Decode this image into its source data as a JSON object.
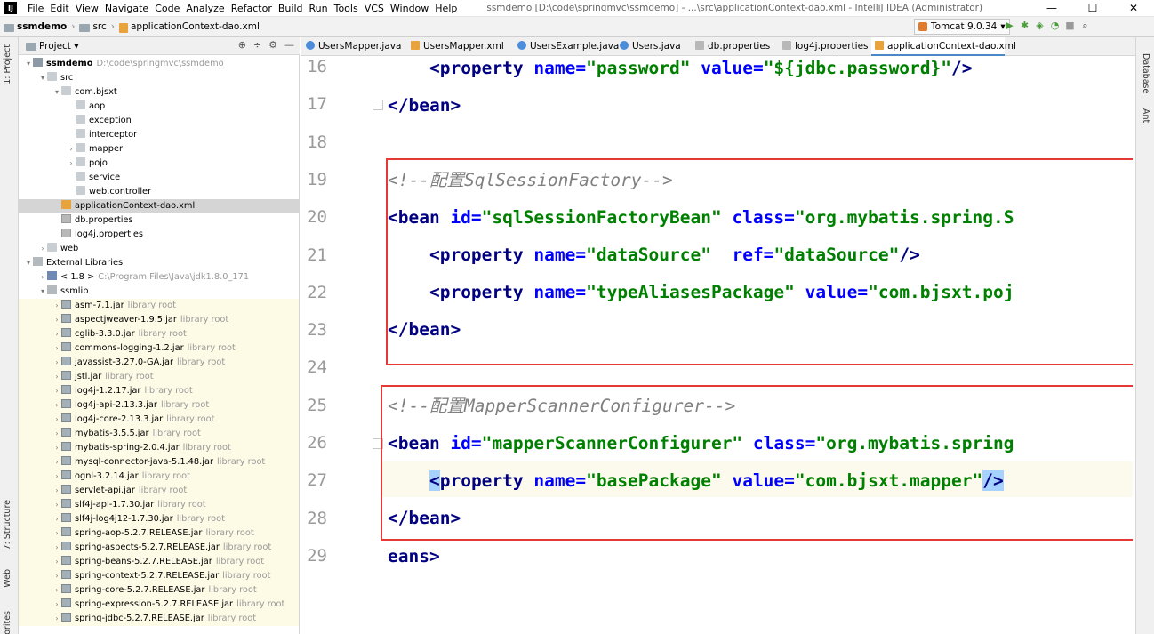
{
  "window": {
    "title": "ssmdemo [D:\\code\\springmvc\\ssmdemo] - ...\\src\\applicationContext-dao.xml - IntelliJ IDEA (Administrator)",
    "app_icon_label": "IJ",
    "min": "—",
    "max": "☐",
    "close": "✕"
  },
  "menu": [
    "File",
    "Edit",
    "View",
    "Navigate",
    "Code",
    "Analyze",
    "Refactor",
    "Build",
    "Run",
    "Tools",
    "VCS",
    "Window",
    "Help"
  ],
  "breadcrumb": {
    "project": "ssmdemo",
    "folder": "src",
    "file": "applicationContext-dao.xml"
  },
  "run_config": {
    "label": "Tomcat 9.0.34",
    "dropdown": "▾"
  },
  "toolbar_icons": [
    "hammer-icon",
    "run-icon",
    "debug-icon",
    "coverage-icon",
    "profile-icon",
    "stop-icon",
    "search-icon"
  ],
  "project_panel": {
    "title": "Project ▾",
    "icons": [
      "⊕",
      "÷",
      "⚙",
      "—"
    ]
  },
  "left_stripe": {
    "project": "1: Project",
    "structure": "7: Structure",
    "web": "Web",
    "favorites": "Favorites"
  },
  "right_stripe": {
    "database": "Database",
    "ant": "Ant"
  },
  "tree": [
    {
      "indent": 0,
      "arrow": "▾",
      "icon": "mod",
      "label": "ssmdemo",
      "muted": "D:\\code\\springmvc\\ssmdemo",
      "bold": true
    },
    {
      "indent": 1,
      "arrow": "▾",
      "icon": "pkg",
      "label": "src"
    },
    {
      "indent": 2,
      "arrow": "▾",
      "icon": "pkg",
      "label": "com.bjsxt"
    },
    {
      "indent": 3,
      "arrow": "",
      "icon": "pkg",
      "label": "aop"
    },
    {
      "indent": 3,
      "arrow": "",
      "icon": "pkg",
      "label": "exception"
    },
    {
      "indent": 3,
      "arrow": "",
      "icon": "pkg",
      "label": "interceptor"
    },
    {
      "indent": 3,
      "arrow": "›",
      "icon": "pkg",
      "label": "mapper"
    },
    {
      "indent": 3,
      "arrow": "›",
      "icon": "pkg",
      "label": "pojo"
    },
    {
      "indent": 3,
      "arrow": "",
      "icon": "pkg",
      "label": "service"
    },
    {
      "indent": 3,
      "arrow": "",
      "icon": "pkg",
      "label": "web.controller"
    },
    {
      "indent": 2,
      "arrow": "",
      "icon": "xml",
      "label": "applicationContext-dao.xml",
      "selected": true
    },
    {
      "indent": 2,
      "arrow": "",
      "icon": "prop",
      "label": "db.properties"
    },
    {
      "indent": 2,
      "arrow": "",
      "icon": "prop",
      "label": "log4j.properties"
    },
    {
      "indent": 1,
      "arrow": "›",
      "icon": "pkg",
      "label": "web"
    },
    {
      "indent": 0,
      "arrow": "▾",
      "icon": "lib",
      "label": "External Libraries"
    },
    {
      "indent": 1,
      "arrow": "›",
      "icon": "jdk",
      "label": "< 1.8 >",
      "muted": "C:\\Program Files\\Java\\jdk1.8.0_171"
    },
    {
      "indent": 1,
      "arrow": "▾",
      "icon": "lib",
      "label": "ssmlib"
    },
    {
      "indent": 2,
      "arrow": "›",
      "icon": "jar",
      "label": "asm-7.1.jar",
      "muted": "library root",
      "lib": true
    },
    {
      "indent": 2,
      "arrow": "›",
      "icon": "jar",
      "label": "aspectjweaver-1.9.5.jar",
      "muted": "library root",
      "lib": true
    },
    {
      "indent": 2,
      "arrow": "›",
      "icon": "jar",
      "label": "cglib-3.3.0.jar",
      "muted": "library root",
      "lib": true
    },
    {
      "indent": 2,
      "arrow": "›",
      "icon": "jar",
      "label": "commons-logging-1.2.jar",
      "muted": "library root",
      "lib": true
    },
    {
      "indent": 2,
      "arrow": "›",
      "icon": "jar",
      "label": "javassist-3.27.0-GA.jar",
      "muted": "library root",
      "lib": true
    },
    {
      "indent": 2,
      "arrow": "›",
      "icon": "jar",
      "label": "jstl.jar",
      "muted": "library root",
      "lib": true
    },
    {
      "indent": 2,
      "arrow": "›",
      "icon": "jar",
      "label": "log4j-1.2.17.jar",
      "muted": "library root",
      "lib": true
    },
    {
      "indent": 2,
      "arrow": "›",
      "icon": "jar",
      "label": "log4j-api-2.13.3.jar",
      "muted": "library root",
      "lib": true
    },
    {
      "indent": 2,
      "arrow": "›",
      "icon": "jar",
      "label": "log4j-core-2.13.3.jar",
      "muted": "library root",
      "lib": true
    },
    {
      "indent": 2,
      "arrow": "›",
      "icon": "jar",
      "label": "mybatis-3.5.5.jar",
      "muted": "library root",
      "lib": true
    },
    {
      "indent": 2,
      "arrow": "›",
      "icon": "jar",
      "label": "mybatis-spring-2.0.4.jar",
      "muted": "library root",
      "lib": true
    },
    {
      "indent": 2,
      "arrow": "›",
      "icon": "jar",
      "label": "mysql-connector-java-5.1.48.jar",
      "muted": "library root",
      "lib": true
    },
    {
      "indent": 2,
      "arrow": "›",
      "icon": "jar",
      "label": "ognl-3.2.14.jar",
      "muted": "library root",
      "lib": true
    },
    {
      "indent": 2,
      "arrow": "›",
      "icon": "jar",
      "label": "servlet-api.jar",
      "muted": "library root",
      "lib": true
    },
    {
      "indent": 2,
      "arrow": "›",
      "icon": "jar",
      "label": "slf4j-api-1.7.30.jar",
      "muted": "library root",
      "lib": true
    },
    {
      "indent": 2,
      "arrow": "›",
      "icon": "jar",
      "label": "slf4j-log4j12-1.7.30.jar",
      "muted": "library root",
      "lib": true
    },
    {
      "indent": 2,
      "arrow": "›",
      "icon": "jar",
      "label": "spring-aop-5.2.7.RELEASE.jar",
      "muted": "library root",
      "lib": true
    },
    {
      "indent": 2,
      "arrow": "›",
      "icon": "jar",
      "label": "spring-aspects-5.2.7.RELEASE.jar",
      "muted": "library root",
      "lib": true
    },
    {
      "indent": 2,
      "arrow": "›",
      "icon": "jar",
      "label": "spring-beans-5.2.7.RELEASE.jar",
      "muted": "library root",
      "lib": true
    },
    {
      "indent": 2,
      "arrow": "›",
      "icon": "jar",
      "label": "spring-context-5.2.7.RELEASE.jar",
      "muted": "library root",
      "lib": true
    },
    {
      "indent": 2,
      "arrow": "›",
      "icon": "jar",
      "label": "spring-core-5.2.7.RELEASE.jar",
      "muted": "library root",
      "lib": true
    },
    {
      "indent": 2,
      "arrow": "›",
      "icon": "jar",
      "label": "spring-expression-5.2.7.RELEASE.jar",
      "muted": "library root",
      "lib": true
    },
    {
      "indent": 2,
      "arrow": "›",
      "icon": "jar",
      "label": "spring-jdbc-5.2.7.RELEASE.jar",
      "muted": "library root",
      "lib": true
    }
  ],
  "tabs": [
    {
      "label": "UsersMapper.java",
      "icon": "java"
    },
    {
      "label": "UsersMapper.xml",
      "icon": "xml"
    },
    {
      "label": "UsersExample.java",
      "icon": "java"
    },
    {
      "label": "Users.java",
      "icon": "java"
    },
    {
      "label": "db.properties",
      "icon": "prop"
    },
    {
      "label": "log4j.properties",
      "icon": "prop"
    },
    {
      "label": "applicationContext-dao.xml",
      "icon": "xml",
      "active": true
    }
  ],
  "editor": {
    "line_numbers": [
      "16",
      "17",
      "18",
      "19",
      "20",
      "21",
      "22",
      "23",
      "24",
      "25",
      "26",
      "27",
      "28",
      "29"
    ],
    "code": {
      "l16": {
        "indent": "    ",
        "open": "<property",
        "a1": " name=",
        "v1": "\"password\"",
        "a2": " value=",
        "v2": "\"${jdbc.password}\"",
        "close": "/>"
      },
      "l17": {
        "text": "</bean>"
      },
      "l19": {
        "text": "<!--配置SqlSessionFactory-->"
      },
      "l20": {
        "open": "<bean",
        "a1": " id=",
        "v1": "\"sqlSessionFactoryBean\"",
        "a2": " class=",
        "v2": "\"org.mybatis.spring.S"
      },
      "l21": {
        "indent": "    ",
        "open": "<property",
        "a1": " name=",
        "v1": "\"dataSource\"",
        "a2": "  ref=",
        "v2": "\"dataSource\"",
        "close": "/>"
      },
      "l22": {
        "indent": "    ",
        "open": "<property",
        "a1": " name=",
        "v1": "\"typeAliasesPackage\"",
        "a2": " value=",
        "v2": "\"com.bjsxt.poj"
      },
      "l23": {
        "text": "</bean>"
      },
      "l25": {
        "text": "<!--配置MapperScannerConfigurer-->"
      },
      "l26": {
        "open": "<bean",
        "a1": " id=",
        "v1": "\"mapperScannerConfigurer\"",
        "a2": " class=",
        "v2": "\"org.mybatis.spring"
      },
      "l27": {
        "indent": "    ",
        "open": "<",
        "open2": "property",
        "a1": " name=",
        "v1": "\"basePackage\"",
        "a2": " value=",
        "v2": "\"com.bjsxt.mapper\"",
        "close": "/>"
      },
      "l28": {
        "text": "</bean>"
      },
      "l29": {
        "text": "eans>"
      }
    }
  },
  "colors": {
    "tag": "#000080",
    "attr": "#0000ff",
    "value": "#008000",
    "comment": "#808080",
    "highlight_box": "#e53935"
  }
}
